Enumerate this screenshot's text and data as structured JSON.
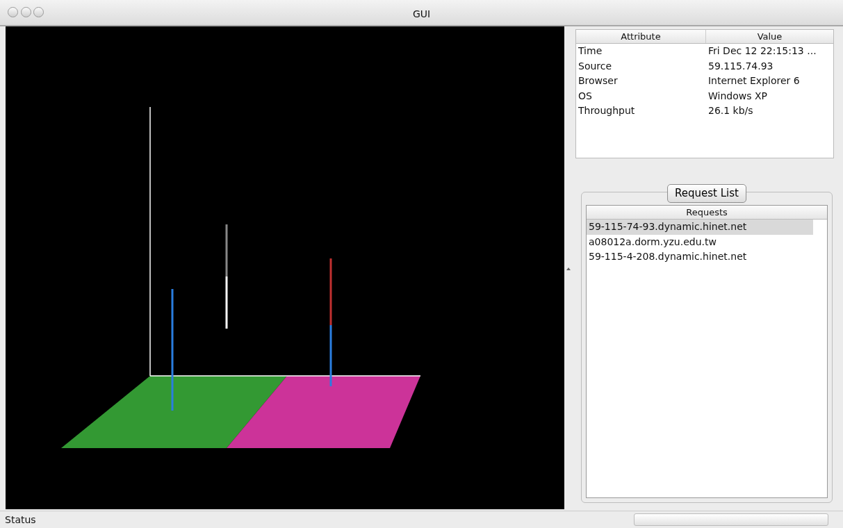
{
  "window": {
    "title": "GUI"
  },
  "attributes": {
    "columns": [
      "Attribute",
      "Value"
    ],
    "rows": [
      {
        "attribute": "Time",
        "value": "Fri Dec 12 22:15:13 ..."
      },
      {
        "attribute": "Source",
        "value": "59.115.74.93"
      },
      {
        "attribute": "Browser",
        "value": "Internet Explorer 6"
      },
      {
        "attribute": "OS",
        "value": "Windows XP"
      },
      {
        "attribute": "Throughput",
        "value": "26.1 kb/s"
      }
    ]
  },
  "request_list": {
    "title": "Request List",
    "column": "Requests",
    "items": [
      {
        "label": "59-115-74-93.dynamic.hinet.net",
        "selected": true
      },
      {
        "label": "a08012a.dorm.yzu.edu.tw",
        "selected": false
      },
      {
        "label": "59-115-4-208.dynamic.hinet.net",
        "selected": false
      }
    ]
  },
  "status_bar": {
    "text": "Status"
  }
}
